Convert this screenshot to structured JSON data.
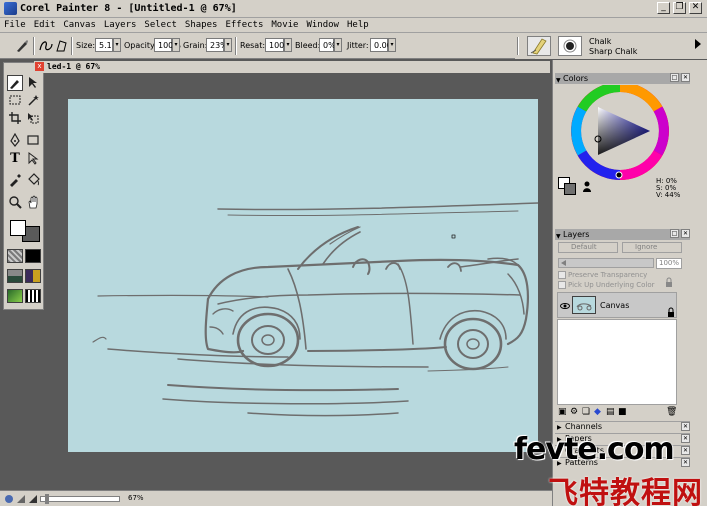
{
  "window": {
    "title": "Corel Painter 8 - [Untitled-1 @ 67%]",
    "minimize_glyph": "_",
    "restore_glyph": "❐",
    "close_glyph": "✕"
  },
  "menu": [
    "File",
    "Edit",
    "Canvas",
    "Layers",
    "Select",
    "Shapes",
    "Effects",
    "Movie",
    "Window",
    "Help"
  ],
  "property_bar": {
    "size_label": "Size:",
    "size_value": "5.1",
    "opacity_label": "Opacity:",
    "opacity_value": "100%",
    "grain_label": "Grain:",
    "grain_value": "23%",
    "resat_label": "Resat:",
    "resat_value": "100%",
    "bleed_label": "Bleed:",
    "bleed_value": "0%",
    "jitter_label": "Jitter:",
    "jitter_value": "0.00"
  },
  "brush_selector": {
    "category": "Chalk",
    "variant": "Sharp Chalk"
  },
  "document": {
    "title": "led-1 @ 67%",
    "close_glyph": "x"
  },
  "status_bar": {
    "zoom": "67%"
  },
  "colors_panel": {
    "title": "Colors",
    "h": "H: 0%",
    "s": "S: 0%",
    "v": "V: 44%"
  },
  "layers_panel": {
    "title": "Layers",
    "composite_method": "Default",
    "composite_depth": "Ignore",
    "opacity": "100%",
    "preserve_transparency": "Preserve Transparency",
    "pick_up_underlying": "Pick Up Underlying Color",
    "layer_name": "Canvas"
  },
  "collapsed_panels": [
    "Channels",
    "Papers",
    "Gradients",
    "Patterns"
  ],
  "watermark": {
    "line1": "fevte.com",
    "line2": "飞特教程网"
  },
  "colors": {
    "paper": "#b8d9de",
    "chrome": "#d4d0c8",
    "workspace": "#595959",
    "sketch_stroke": "#6e6e6e",
    "watermark_red": "#c01010"
  }
}
